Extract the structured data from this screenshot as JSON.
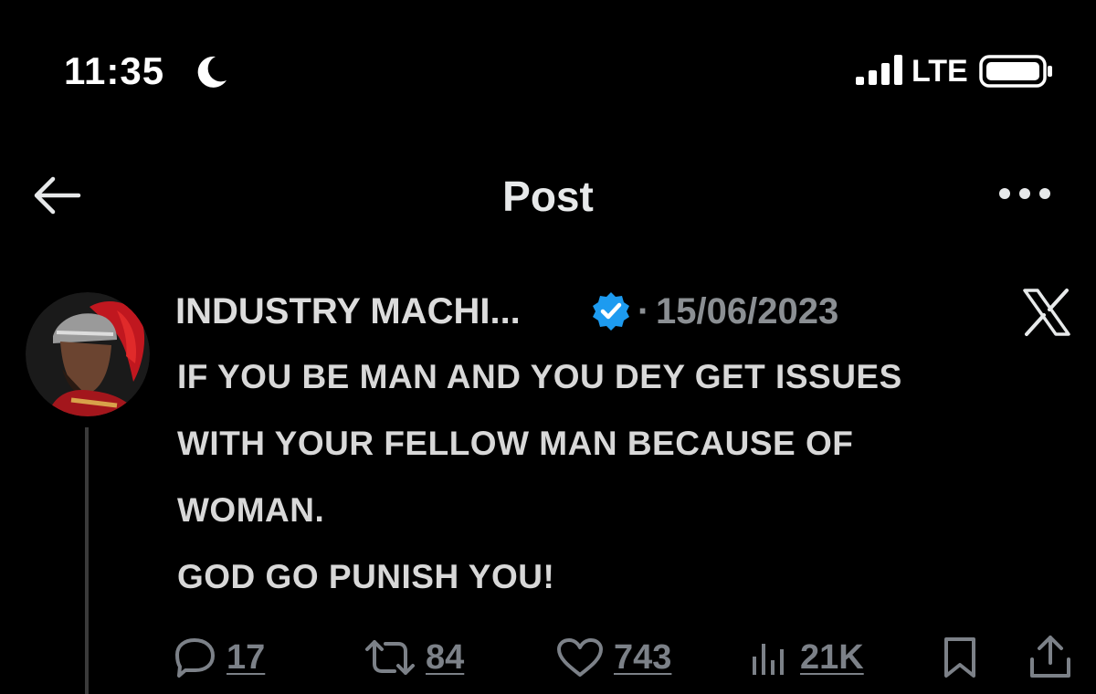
{
  "status_bar": {
    "time": "11:35",
    "network": "LTE",
    "icons": [
      "moon-icon",
      "signal-icon",
      "battery-icon"
    ]
  },
  "header": {
    "title": "Post",
    "back_icon": "back-arrow-icon",
    "more_icon": "more-icon"
  },
  "post": {
    "author_name": "INDUSTRY MACHI...",
    "verified": true,
    "separator": "·",
    "date": "15/06/2023",
    "source_icon": "x-logo-icon",
    "lines": [
      "IF YOU BE MAN AND YOU DEY GET ISSUES",
      "WITH YOUR FELLOW MAN BECAUSE OF",
      "WOMAN.",
      "GOD GO PUNISH YOU!"
    ],
    "actions": {
      "replies": "17",
      "reposts": "84",
      "likes": "743",
      "views": "21K"
    }
  },
  "colors": {
    "background": "#000000",
    "text": "#e7e9ea",
    "muted": "#8b8f93",
    "verified": "#1d9bf0"
  }
}
